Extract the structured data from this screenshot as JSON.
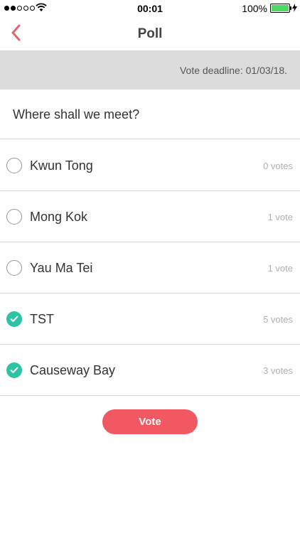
{
  "status_bar": {
    "time": "00:01",
    "battery_percent": "100%",
    "signal_bars_filled": 2,
    "signal_bars_total": 5,
    "icons": [
      "signal-dots-icon",
      "wifi-icon",
      "battery-icon",
      "charging-bolt-icon"
    ]
  },
  "nav": {
    "title": "Poll",
    "back_icon": "chevron-left-icon"
  },
  "deadline": {
    "text": "Vote deadline: 01/03/18."
  },
  "question": {
    "text": "Where shall we meet?"
  },
  "options": [
    {
      "label": "Kwun Tong",
      "votes": "0 votes",
      "checked": false
    },
    {
      "label": "Mong Kok",
      "votes": "1 vote",
      "checked": false
    },
    {
      "label": "Yau Ma Tei",
      "votes": "1 vote",
      "checked": false
    },
    {
      "label": "TST",
      "votes": "5 votes",
      "checked": true
    },
    {
      "label": "Causeway Bay",
      "votes": "3 votes",
      "checked": true
    }
  ],
  "vote_button": {
    "label": "Vote"
  },
  "colors": {
    "accent": "#f25862",
    "checked": "#2bc4a5",
    "back_icon": "#e0666d",
    "deadline_bg": "#dcdcdc"
  }
}
